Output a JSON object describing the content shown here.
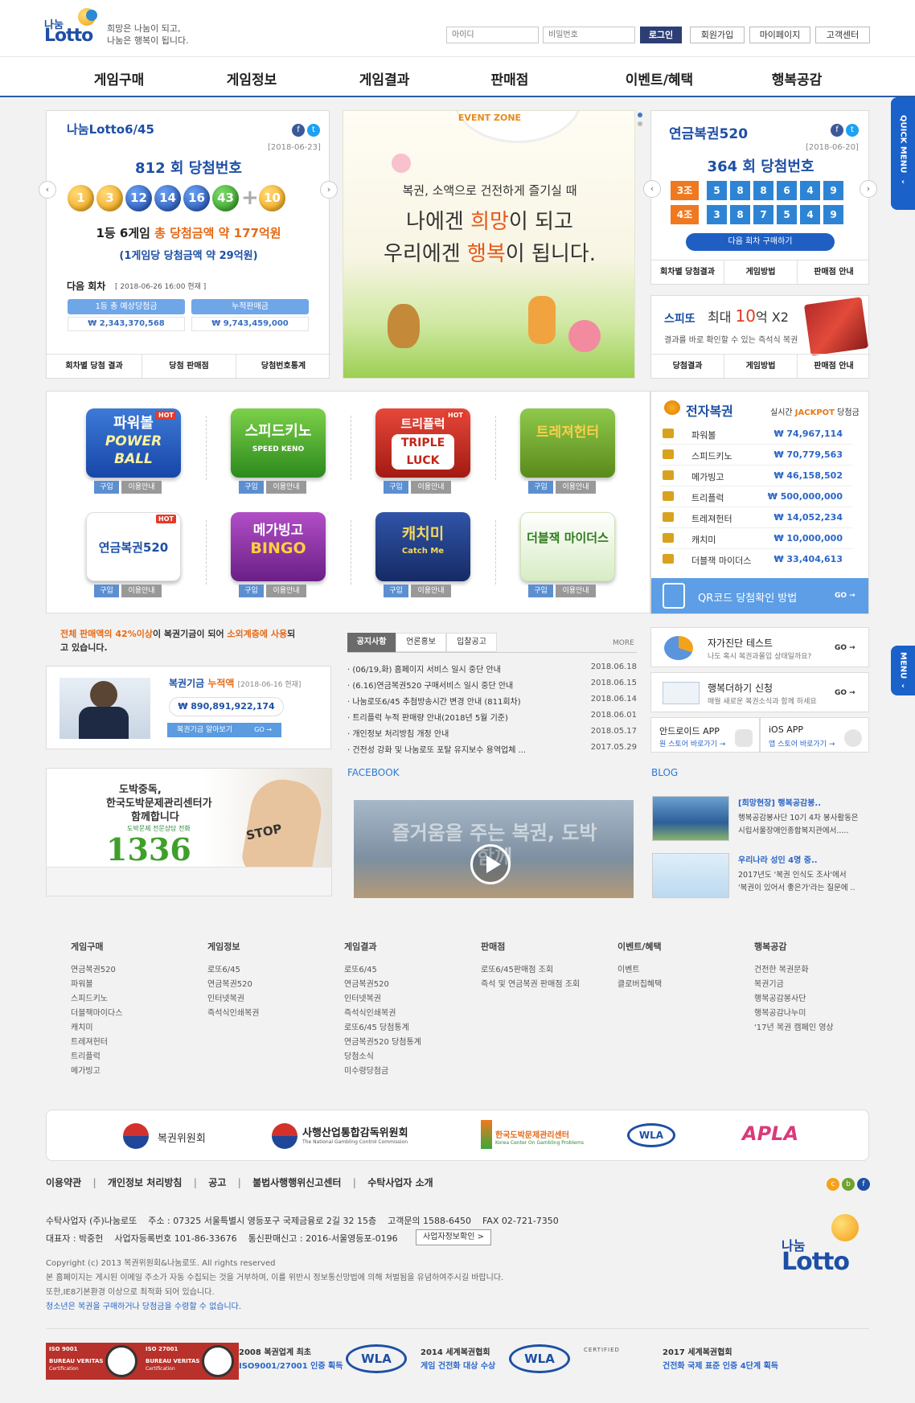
{
  "header": {
    "logo_top": "나눔",
    "logo_main": "Lotto",
    "slogan1": "희망은 나눔이 되고,",
    "slogan2": "나눔은 행복이 됩니다.",
    "id_placeholder": "아이디",
    "pw_placeholder": "비밀번호",
    "login": "로그인",
    "join": "회원가입",
    "mypage": "마이페이지",
    "support": "고객센터"
  },
  "nav": [
    "게임구매",
    "게임정보",
    "게임결과",
    "판매점",
    "이벤트/혜택",
    "행복공감"
  ],
  "lotto645": {
    "brand": "나눔Lotto6/45",
    "date": "[2018-06-23]",
    "round": "812 회 당첨번호",
    "balls": [
      "1",
      "3",
      "12",
      "14",
      "16",
      "43"
    ],
    "bonus": "10",
    "prize_line": "1등 6게임",
    "prize_total": "총 당첨금액 약 177억원",
    "prize_each": "(1게임당 당첨금액 약 29억원)",
    "next_label": "다음 회차",
    "next_time": "[ 2018-06-26 16:00 현재 ]",
    "est_label": "1등 총 예상당첨금",
    "est_value": "₩ 2,343,370,568",
    "sales_label": "누적판매금",
    "sales_value": "₩ 9,743,459,000",
    "tabs": [
      "회차별 당첨 결과",
      "당첨 판매점",
      "당첨번호통계"
    ]
  },
  "event": {
    "zone": "EVENT ZONE",
    "line1": "복권, 소액으로 건전하게 즐기실 때",
    "line2a": "나에겐 ",
    "line2b": "희망",
    "line2c": "이 되고",
    "line3a": "우리에겐 ",
    "line3b": "행복",
    "line3c": "이 됩니다."
  },
  "pension": {
    "brand": "연금복권520",
    "date": "[2018-06-20]",
    "round": "364 회 당첨번호",
    "row1_label": "3조",
    "row1": [
      "5",
      "8",
      "8",
      "6",
      "4",
      "9"
    ],
    "row2_label": "4조",
    "row2": [
      "3",
      "8",
      "7",
      "5",
      "4",
      "9"
    ],
    "buy_next": "다음 회차 구매하기",
    "tabs": [
      "회차별 당첨결과",
      "게임방법",
      "판매점 안내"
    ]
  },
  "speeto": {
    "brand": "스피또",
    "headline_a": "최대 ",
    "headline_b": "10",
    "headline_c": "억 X2",
    "desc": "결과를 바로 확인할 수 있는 즉석식 복권",
    "tabs": [
      "당첨결과",
      "게임방법",
      "판매점 안내"
    ]
  },
  "games": [
    {
      "name": "파워볼",
      "sub": "POWER BALL",
      "hot": "HOT",
      "buy": "구입",
      "info": "이용안내"
    },
    {
      "name": "스피드키노",
      "sub": "SPEED KENO",
      "hot": "",
      "buy": "구입",
      "info": "이용안내"
    },
    {
      "name": "트리플럭",
      "sub": "TRIPLE LUCK",
      "hot": "HOT",
      "buy": "구입",
      "info": "이용안내"
    },
    {
      "name": "트레져헌터",
      "sub": "",
      "hot": "",
      "buy": "구입",
      "info": "이용안내"
    },
    {
      "name": "연금복권520",
      "sub": "",
      "hot": "HOT",
      "buy": "구입",
      "info": "이용안내"
    },
    {
      "name": "메가빙고",
      "sub": "BINGO",
      "hot": "",
      "buy": "구입",
      "info": "이용안내"
    },
    {
      "name": "캐치미",
      "sub": "Catch Me",
      "hot": "",
      "buy": "구입",
      "info": "이용안내"
    },
    {
      "name": "더블잭 마이더스",
      "sub": "",
      "hot": "",
      "buy": "구입",
      "info": "이용안내"
    }
  ],
  "jackpot": {
    "title": "전자복권",
    "subtitle_a": "실시간 ",
    "subtitle_b": "JACKPOT",
    "subtitle_c": " 당첨금",
    "rows": [
      {
        "name": "파워볼",
        "value": "₩ 74,967,114"
      },
      {
        "name": "스피드키노",
        "value": "₩ 70,779,563"
      },
      {
        "name": "메가빙고",
        "value": "₩ 46,158,502"
      },
      {
        "name": "트리플럭",
        "value": "₩ 500,000,000"
      },
      {
        "name": "트레져헌터",
        "value": "₩ 14,052,234"
      },
      {
        "name": "캐치미",
        "value": "₩ 10,000,000"
      },
      {
        "name": "더블잭 마이더스",
        "value": "₩ 33,404,613"
      }
    ],
    "qr": "QR코드 당첨확인 방법",
    "go": "GO →"
  },
  "fund": {
    "msg_a": "전체 판매액의 ",
    "msg_b": "42%이상",
    "msg_c": "이 복권기금이 되어 ",
    "msg_d": "소외계층에 사용",
    "msg_e": "되고",
    "msg_f": "있습니다.",
    "title_a": "복권기금 ",
    "title_b": "누적액",
    "date": "[2018-06-16 현재]",
    "value": "₩ 890,891,922,174",
    "more": "복권기금 알아보기",
    "go": "GO →"
  },
  "notice": {
    "tabs": [
      "공지사항",
      "언론홍보",
      "입찰공고"
    ],
    "more": "MORE",
    "rows": [
      {
        "title": "· (06/19,화) 홈페이지 서비스 일시 중단 안내",
        "date": "2018.06.18"
      },
      {
        "title": "· (6.16)연금복권520 구매서비스 일시 중단 안내",
        "date": "2018.06.15"
      },
      {
        "title": "· 나눔로또6/45 추첨방송시간 변경 안내 (811회차)",
        "date": "2018.06.14"
      },
      {
        "title": "· 트리플럭 누적 판매량 안내(2018년 5월 기준)",
        "date": "2018.06.01"
      },
      {
        "title": "· 개인정보 처리방침 개정 안내",
        "date": "2018.05.17"
      },
      {
        "title": "· 건전성 강화 및 나눔로또 포탈 유지보수 용역업체 ...",
        "date": "2017.05.29"
      }
    ]
  },
  "side": {
    "diag_title": "자가진단 테스트",
    "diag_desc": "나도 혹시 복권과몰입 상태일까요?",
    "news_title": "행복더하기 신청",
    "news_desc": "매월 새로운 복권소식과 함께 하세요",
    "go": "GO →",
    "android": "안드로이드 APP",
    "android_sub": "원 스토어 바로가기 →",
    "ios": "iOS APP",
    "ios_sub": "앱 스토어 바로가기 →"
  },
  "gambling": {
    "line1": "도박중독,",
    "line2": "한국도박문제관리센터가",
    "line3": "함께합니다",
    "sub": "도박문제 전문상담 전화",
    "phone": "1336",
    "stop": "STOP"
  },
  "facebook": {
    "title": "FACEBOOK",
    "caption": "즐거움을 주는 복권, 도박 함께"
  },
  "blog": {
    "title": "BLOG",
    "items": [
      {
        "title": "[희망현장] 행복공감봉..",
        "desc1": "행복공감봉사단 10기 4차 봉사활동은",
        "desc2": "시립서울장애인종합복지관에서....."
      },
      {
        "title": "우리나라 성인 4명 중..",
        "desc1": "2017년도 '복권 인식도 조사'에서",
        "desc2": "'복권이 있어서 좋은가'라는 질문에 .."
      }
    ]
  },
  "sitemap": [
    {
      "title": "게임구매",
      "items": [
        "연금복권520",
        "파워볼",
        "스피드키노",
        "더블잭마이다스",
        "캐치미",
        "트레져헌터",
        "트리플럭",
        "메가빙고"
      ]
    },
    {
      "title": "게임정보",
      "items": [
        "로또6/45",
        "연금복권520",
        "인터넷복권",
        "즉석식인쇄복권"
      ]
    },
    {
      "title": "게임결과",
      "items": [
        "로또6/45",
        "연금복권520",
        "인터넷복권",
        "즉석식인쇄복권",
        "로또6/45 당첨통계",
        "연금복권520 당첨통계",
        "당첨소식",
        "미수령당첨금"
      ]
    },
    {
      "title": "판매점",
      "items": [
        "로또6/45판매점 조회",
        "즉석 및 연금복권 판매점 조회"
      ]
    },
    {
      "title": "이벤트/혜택",
      "items": [
        "이벤트",
        "클로버칩혜택"
      ]
    },
    {
      "title": "행복공감",
      "items": [
        "건전한 복권문화",
        "복권기금",
        "행복공감봉사단",
        "행복공감나누미",
        "'17년 복권 캠페인 영상"
      ]
    }
  ],
  "partners": [
    "복권위원회",
    "사행산업통합감독위원회",
    "한국도박문제관리센터",
    "WLA",
    "APLA"
  ],
  "partner_subs": {
    "ngcc": "The National Gambling Control Commission",
    "kcgp": "Korea Center On Gambling Problems"
  },
  "links": [
    "이용약관",
    "개인정보 처리방침",
    "공고",
    "불법사행행위신고센터",
    "수탁사업자 소개"
  ],
  "company": {
    "line1": "수탁사업자 (주)나눔로또    주소 : 07325 서울특별시 영등포구 국제금융로 2길 32 15층    고객문의 1588-6450    FAX 02-721-7350",
    "line2": "대표자 : 박중헌    사업자등록번호 101-86-33676    통신판매신고 : 2016-서울영등포-0196",
    "verify": "사업자정보확인 >",
    "copy": "Copyright (c) 2013 복권위원회&나눔로또. All rights reserved",
    "notice1": "본 홈페이지는 게시된 이메일 주소가 자동 수집되는 것을 거부하며, 이를 위반시 정보통신망법에 의해 처벌됨을 유념하여주시길 바랍니다.",
    "notice2": "또한,IE8기본환경 이상으로 최적화 되어 있습니다.",
    "youth": "청소년은 복권을 구매하거나 당첨금을 수령할 수 없습니다."
  },
  "certs": [
    {
      "badge": "ISO 9001",
      "org": "BUREAU VERITAS",
      "sub": "Certification"
    },
    {
      "badge": "ISO 27001",
      "org": "BUREAU VERITAS",
      "sub": "Certification"
    }
  ],
  "awards": [
    {
      "title": "2008 복권업계 최초",
      "sub": "ISO9001/27001 인증 획득"
    },
    {
      "title": "2014 세계복권협회",
      "sub": "게임 건전화 대상 수상"
    },
    {
      "title": "2017 세계복권협회",
      "sub": "건전화 국제 표준 인증 4단계 획득"
    }
  ],
  "certified": "CERTIFIED",
  "quickmenu": "QUICK MENU",
  "menu2": "MENU"
}
